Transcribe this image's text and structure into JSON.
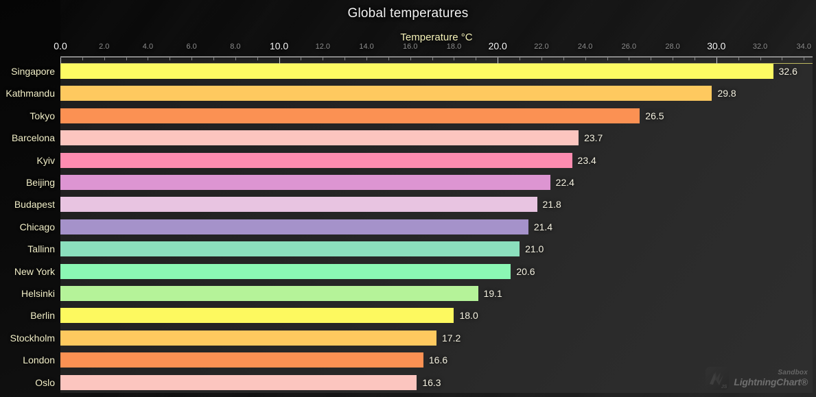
{
  "chart_data": {
    "type": "bar",
    "orientation": "horizontal",
    "title": "Global temperatures",
    "xlabel": "Temperature °C",
    "ylabel": "",
    "xlim": [
      0,
      34.4
    ],
    "grid": false,
    "legend": null,
    "categories": [
      "Singapore",
      "Kathmandu",
      "Tokyo",
      "Barcelona",
      "Kyiv",
      "Beijing",
      "Budapest",
      "Chicago",
      "Tallinn",
      "New York",
      "Helsinki",
      "Berlin",
      "Stockholm",
      "London",
      "Oslo"
    ],
    "values": [
      32.6,
      29.8,
      26.5,
      23.7,
      23.4,
      22.4,
      21.8,
      21.4,
      21.0,
      20.6,
      19.1,
      18.0,
      17.2,
      16.6,
      16.3
    ],
    "value_labels": [
      "32.6",
      "29.8",
      "26.5",
      "23.7",
      "23.4",
      "22.4",
      "21.8",
      "21.4",
      "21.0",
      "20.6",
      "19.1",
      "18.0",
      "17.2",
      "16.6",
      "16.3"
    ],
    "bar_colors": [
      "#fdfb63",
      "#fec95f",
      "#fb9153",
      "#fcc5bf",
      "#fd8cb0",
      "#dd95d2",
      "#e8c4e1",
      "#a592ca",
      "#8bdfbd",
      "#8bf8b4",
      "#b5f399",
      "#fdf95f",
      "#fec95f",
      "#fb9153",
      "#fcc5bf"
    ],
    "axis_ticks": [
      {
        "value": 0,
        "label": "0.0",
        "major": true
      },
      {
        "value": 1,
        "label": "",
        "major": false
      },
      {
        "value": 2,
        "label": "2.0",
        "major": false
      },
      {
        "value": 3,
        "label": "",
        "major": false
      },
      {
        "value": 4,
        "label": "4.0",
        "major": false
      },
      {
        "value": 5,
        "label": "",
        "major": false
      },
      {
        "value": 6,
        "label": "6.0",
        "major": false
      },
      {
        "value": 7,
        "label": "",
        "major": false
      },
      {
        "value": 8,
        "label": "8.0",
        "major": false
      },
      {
        "value": 9,
        "label": "",
        "major": false
      },
      {
        "value": 10,
        "label": "10.0",
        "major": true
      },
      {
        "value": 11,
        "label": "",
        "major": false
      },
      {
        "value": 12,
        "label": "12.0",
        "major": false
      },
      {
        "value": 13,
        "label": "",
        "major": false
      },
      {
        "value": 14,
        "label": "14.0",
        "major": false
      },
      {
        "value": 15,
        "label": "",
        "major": false
      },
      {
        "value": 16,
        "label": "16.0",
        "major": false
      },
      {
        "value": 17,
        "label": "",
        "major": false
      },
      {
        "value": 18,
        "label": "18.0",
        "major": false
      },
      {
        "value": 19,
        "label": "",
        "major": false
      },
      {
        "value": 20,
        "label": "20.0",
        "major": true
      },
      {
        "value": 21,
        "label": "",
        "major": false
      },
      {
        "value": 22,
        "label": "22.0",
        "major": false
      },
      {
        "value": 23,
        "label": "",
        "major": false
      },
      {
        "value": 24,
        "label": "24.0",
        "major": false
      },
      {
        "value": 25,
        "label": "",
        "major": false
      },
      {
        "value": 26,
        "label": "26.0",
        "major": false
      },
      {
        "value": 27,
        "label": "",
        "major": false
      },
      {
        "value": 28,
        "label": "28.0",
        "major": false
      },
      {
        "value": 29,
        "label": "",
        "major": false
      },
      {
        "value": 30,
        "label": "30.0",
        "major": true
      },
      {
        "value": 31,
        "label": "",
        "major": false
      },
      {
        "value": 32,
        "label": "32.0",
        "major": false
      },
      {
        "value": 33,
        "label": "",
        "major": false
      },
      {
        "value": 34,
        "label": "34.0",
        "major": false
      }
    ]
  },
  "theme": {
    "title_color": "#f2f2f2",
    "axis_title_color": "#f5f2b8",
    "category_label_color": "#f2efc8",
    "value_label_color": "#f4f1e0",
    "major_tick_label_color": "#f6f6f6",
    "minor_tick_label_color": "#8e8e8e",
    "axis_line_color": "#8c8c8c",
    "axis_accent_color": "#d8d36a",
    "plot_background": "#2a2a2a",
    "page_background": "#101010"
  },
  "watermark": {
    "sandbox_label": "Sandbox",
    "product_label": "LightningChart®",
    "logo_label": "JS"
  }
}
